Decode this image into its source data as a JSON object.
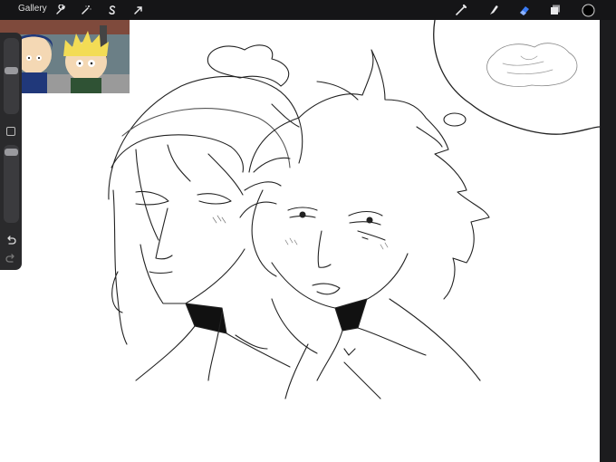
{
  "topbar": {
    "gallery_label": "Gallery",
    "left_tools": [
      "wrench-icon",
      "magic-wand-icon",
      "selection-icon",
      "transform-arrow-icon"
    ],
    "right_tools": [
      "brush-icon",
      "smudge-icon",
      "eraser-icon",
      "layers-icon",
      "color-swatch"
    ],
    "active_tool": "eraser-icon",
    "accent_color": "#3a7bf5",
    "current_color": "#000000"
  },
  "sidebar": {
    "controls": [
      "brush-size-slider",
      "modify-button",
      "opacity-slider",
      "undo-icon",
      "redo-icon"
    ]
  },
  "canvas": {
    "background": "#ffffff"
  },
  "reference": {
    "kind": "reference-image"
  }
}
